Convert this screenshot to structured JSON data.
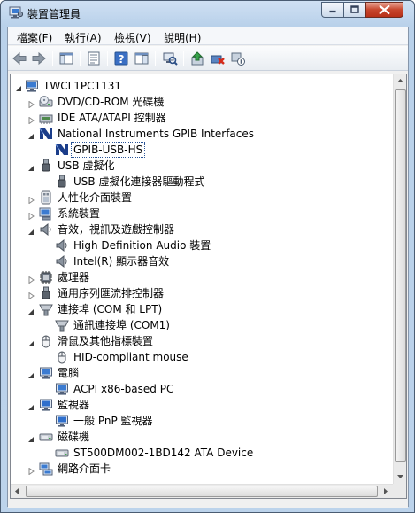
{
  "window": {
    "title": "裝置管理員"
  },
  "menu": [
    {
      "label": "檔案(F)"
    },
    {
      "label": "執行(A)"
    },
    {
      "label": "檢視(V)"
    },
    {
      "label": "說明(H)"
    }
  ],
  "toolbar": [
    {
      "name": "back-icon"
    },
    {
      "name": "forward-icon"
    },
    {
      "name": "show-hide-console-tree-icon"
    },
    {
      "name": "properties-icon"
    },
    {
      "name": "help-icon"
    },
    {
      "name": "show-action-pane-icon"
    },
    {
      "name": "scan-hardware-changes-icon"
    },
    {
      "name": "update-driver-icon"
    },
    {
      "name": "uninstall-device-icon"
    },
    {
      "name": "disable-device-icon"
    }
  ],
  "tree": {
    "root": "TWCL1PC1131",
    "items": [
      {
        "label": "DVD/CD-ROM 光碟機",
        "level": 1,
        "expand": "collapsed",
        "icon": "dvd-drive-icon"
      },
      {
        "label": "IDE ATA/ATAPI 控制器",
        "level": 1,
        "expand": "collapsed",
        "icon": "ide-controller-icon"
      },
      {
        "label": "National Instruments GPIB Interfaces",
        "level": 1,
        "expand": "expanded",
        "icon": "ni-gpib-icon"
      },
      {
        "label": "GPIB-USB-HS",
        "level": 2,
        "expand": "none",
        "icon": "ni-gpib-icon",
        "selected": true
      },
      {
        "label": "USB 虛擬化",
        "level": 1,
        "expand": "expanded",
        "icon": "usb-icon"
      },
      {
        "label": "USB 虛擬化連接器驅動程式",
        "level": 2,
        "expand": "none",
        "icon": "usb-icon"
      },
      {
        "label": "人性化介面裝置",
        "level": 1,
        "expand": "collapsed",
        "icon": "hid-icon"
      },
      {
        "label": "系統裝置",
        "level": 1,
        "expand": "collapsed",
        "icon": "system-device-icon"
      },
      {
        "label": "音效，視訊及遊戲控制器",
        "level": 1,
        "expand": "expanded",
        "icon": "speaker-icon"
      },
      {
        "label": "High Definition Audio 裝置",
        "level": 2,
        "expand": "none",
        "icon": "speaker-icon"
      },
      {
        "label": "Intel(R) 顯示器音效",
        "level": 2,
        "expand": "none",
        "icon": "speaker-icon"
      },
      {
        "label": "處理器",
        "level": 1,
        "expand": "collapsed",
        "icon": "processor-icon"
      },
      {
        "label": "通用序列匯流排控制器",
        "level": 1,
        "expand": "collapsed",
        "icon": "usb-icon"
      },
      {
        "label": "連接埠 (COM 和 LPT)",
        "level": 1,
        "expand": "expanded",
        "icon": "port-icon"
      },
      {
        "label": "通訊連接埠 (COM1)",
        "level": 2,
        "expand": "none",
        "icon": "port-icon"
      },
      {
        "label": "滑鼠及其他指標裝置",
        "level": 1,
        "expand": "expanded",
        "icon": "mouse-icon"
      },
      {
        "label": "HID-compliant mouse",
        "level": 2,
        "expand": "none",
        "icon": "mouse-icon"
      },
      {
        "label": "電腦",
        "level": 1,
        "expand": "expanded",
        "icon": "computer-icon"
      },
      {
        "label": "ACPI x86-based PC",
        "level": 2,
        "expand": "none",
        "icon": "computer-icon"
      },
      {
        "label": "監視器",
        "level": 1,
        "expand": "expanded",
        "icon": "monitor-icon"
      },
      {
        "label": "一般 PnP 監視器",
        "level": 2,
        "expand": "none",
        "icon": "monitor-icon"
      },
      {
        "label": "磁碟機",
        "level": 1,
        "expand": "expanded",
        "icon": "disk-drive-icon"
      },
      {
        "label": "ST500DM002-1BD142 ATA Device",
        "level": 2,
        "expand": "none",
        "icon": "disk-drive-icon"
      },
      {
        "label": "網路介面卡",
        "level": 1,
        "expand": "collapsed",
        "icon": "network-adapter-icon"
      }
    ]
  }
}
